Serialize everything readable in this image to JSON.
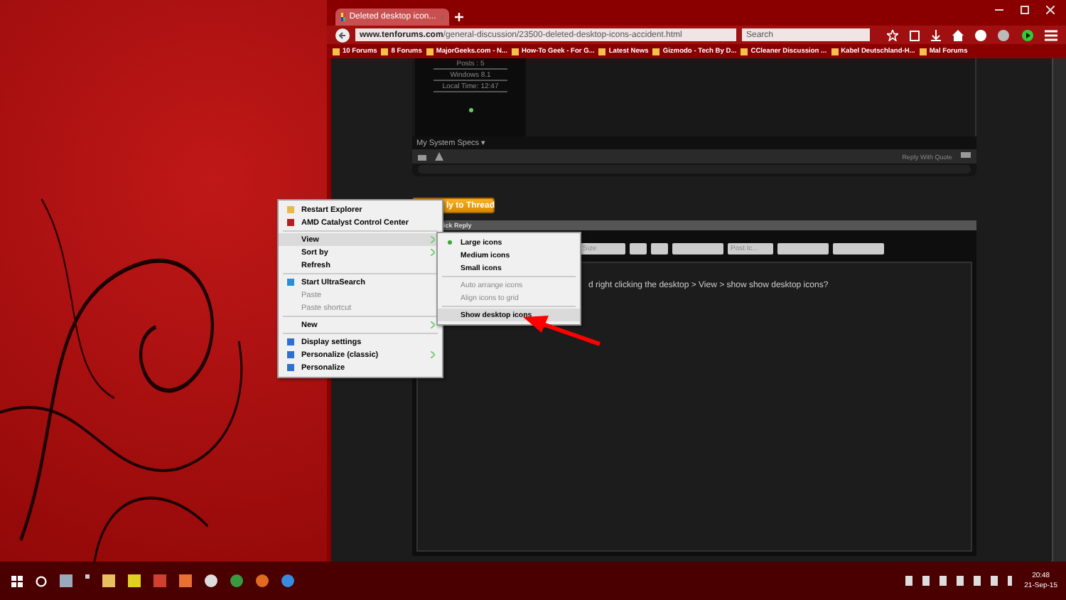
{
  "browser": {
    "tab_title": "Deleted desktop icon...",
    "url_domain": "www.tenforums.com",
    "url_path": "/general-discussion/23500-deleted-desktop-icons-accident.html",
    "search": {
      "placeholder": "Search"
    },
    "bookmarks": [
      "10 Forums",
      "8 Forums",
      "MajorGeeks.com - N...",
      "How-To Geek - For G...",
      "Latest News",
      "Gizmodo - Tech By D...",
      "CCleaner Discussion ...",
      "Kabel Deutschland-H...",
      "Mal Forums"
    ]
  },
  "post": {
    "user_stats": [
      "Posts : 5",
      "Windows 8.1",
      "Local Time: 12:47"
    ],
    "specs_link": "My System Specs ▾",
    "reply_with_quote": "Reply With Quote"
  },
  "reply_button": "ly to Thread",
  "quick_reply_header": "ick Reply",
  "editor": {
    "toolbar_selects": [
      "Size",
      "Post Ic..."
    ],
    "text": "d right clicking the desktop > View > show show desktop icons?"
  },
  "context_menu": [
    {
      "kind": "item",
      "label": "Restart Explorer",
      "submenu": false,
      "disabled": false,
      "selected": false
    },
    {
      "kind": "item",
      "label": "AMD Catalyst Control Center",
      "submenu": false,
      "disabled": false,
      "selected": false
    },
    {
      "kind": "separator"
    },
    {
      "kind": "item",
      "label": "View",
      "submenu": true,
      "disabled": false,
      "selected": true
    },
    {
      "kind": "item",
      "label": "Sort by",
      "submenu": true,
      "disabled": false,
      "selected": false
    },
    {
      "kind": "item",
      "label": "Refresh",
      "submenu": false,
      "disabled": false,
      "selected": false
    },
    {
      "kind": "separator"
    },
    {
      "kind": "item",
      "label": "Start UltraSearch",
      "submenu": false,
      "disabled": false,
      "selected": false
    },
    {
      "kind": "item",
      "label": "Paste",
      "submenu": false,
      "disabled": true,
      "selected": false
    },
    {
      "kind": "item",
      "label": "Paste shortcut",
      "submenu": false,
      "disabled": true,
      "selected": false
    },
    {
      "kind": "separator"
    },
    {
      "kind": "item",
      "label": "New",
      "submenu": true,
      "disabled": false,
      "selected": false
    },
    {
      "kind": "separator"
    },
    {
      "kind": "item",
      "label": "Display settings",
      "submenu": false,
      "disabled": false,
      "selected": false
    },
    {
      "kind": "item",
      "label": "Personalize (classic)",
      "submenu": true,
      "disabled": false,
      "selected": false
    },
    {
      "kind": "item",
      "label": "Personalize",
      "submenu": false,
      "disabled": false,
      "selected": false
    }
  ],
  "view_submenu": [
    {
      "kind": "item",
      "label": "Large icons",
      "checked": true,
      "disabled": false,
      "selected": false
    },
    {
      "kind": "item",
      "label": "Medium icons",
      "checked": false,
      "disabled": false,
      "selected": false
    },
    {
      "kind": "item",
      "label": "Small icons",
      "checked": false,
      "disabled": false,
      "selected": false
    },
    {
      "kind": "separator"
    },
    {
      "kind": "item",
      "label": "Auto arrange icons",
      "checked": false,
      "disabled": true,
      "selected": false
    },
    {
      "kind": "item",
      "label": "Align icons to grid",
      "checked": false,
      "disabled": true,
      "selected": false
    },
    {
      "kind": "separator"
    },
    {
      "kind": "item",
      "label": "Show desktop icons",
      "checked": false,
      "disabled": false,
      "selected": true
    }
  ],
  "taskbar": {
    "time": "20:48",
    "date": "21-Sep-15"
  }
}
